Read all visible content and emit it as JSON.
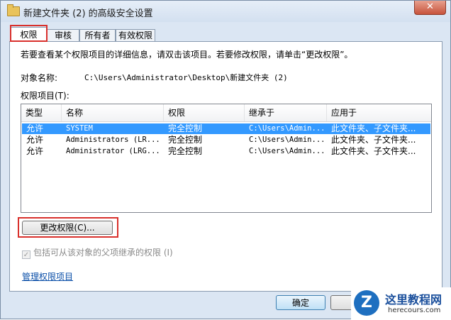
{
  "window": {
    "title": "新建文件夹 (2) 的高级安全设置",
    "close_label": "✕"
  },
  "tabs": [
    {
      "label": "权限",
      "active": true
    },
    {
      "label": "审核",
      "active": false
    },
    {
      "label": "所有者",
      "active": false
    },
    {
      "label": "有效权限",
      "active": false
    }
  ],
  "panel": {
    "info_text": "若要查看某个权限项目的详细信息，请双击该项目。若要修改权限，请单击“更改权限”。",
    "object_name_label": "对象名称:",
    "object_name_value": "C:\\Users\\Administrator\\Desktop\\新建文件夹 (2)",
    "entries_label": "权限项目(T):",
    "columns": [
      "类型",
      "名称",
      "权限",
      "继承于",
      "应用于"
    ],
    "rows": [
      {
        "type": "允许",
        "name": "SYSTEM",
        "permission": "完全控制",
        "inherited": "C:\\Users\\Admin...",
        "applies": "此文件夹、子文件夹...",
        "selected": true
      },
      {
        "type": "允许",
        "name": "Administrators (LR...",
        "permission": "完全控制",
        "inherited": "C:\\Users\\Admin...",
        "applies": "此文件夹、子文件夹...",
        "selected": false
      },
      {
        "type": "允许",
        "name": "Administrator (LRG...",
        "permission": "完全控制",
        "inherited": "C:\\Users\\Admin...",
        "applies": "此文件夹、子文件夹...",
        "selected": false
      }
    ],
    "change_button": "更改权限(C)...",
    "inherit_checkbox": "包括可从该对象的父项继承的权限 (I)",
    "inherit_checked": true,
    "manage_link": "管理权限项目"
  },
  "footer": {
    "ok_label": "确定"
  },
  "watermark": {
    "logo": "Z",
    "name": "这里教程网",
    "url": "herecours.com"
  },
  "colors": {
    "highlight": "#d9302c",
    "selection": "#3399ff",
    "link": "#0b4fa8"
  }
}
